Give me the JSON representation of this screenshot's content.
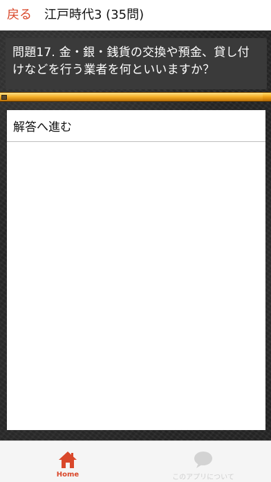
{
  "header": {
    "back_label": "戻る",
    "title": "江戸時代3 (35問)"
  },
  "question": {
    "text": "問題17. 金・銀・銭貨の交換や預金、貸し付けなどを行う業者を何といいますか？"
  },
  "progress": {
    "value": 0.97
  },
  "answer": {
    "button_label": "解答へ進む"
  },
  "tabbar": {
    "home_label": "Home",
    "about_label": "このアプリについて",
    "home_icon": "home-icon",
    "about_icon": "speech-bubble-icon"
  },
  "colors": {
    "accent": "#d9482b",
    "progress": "#f2a51a"
  }
}
